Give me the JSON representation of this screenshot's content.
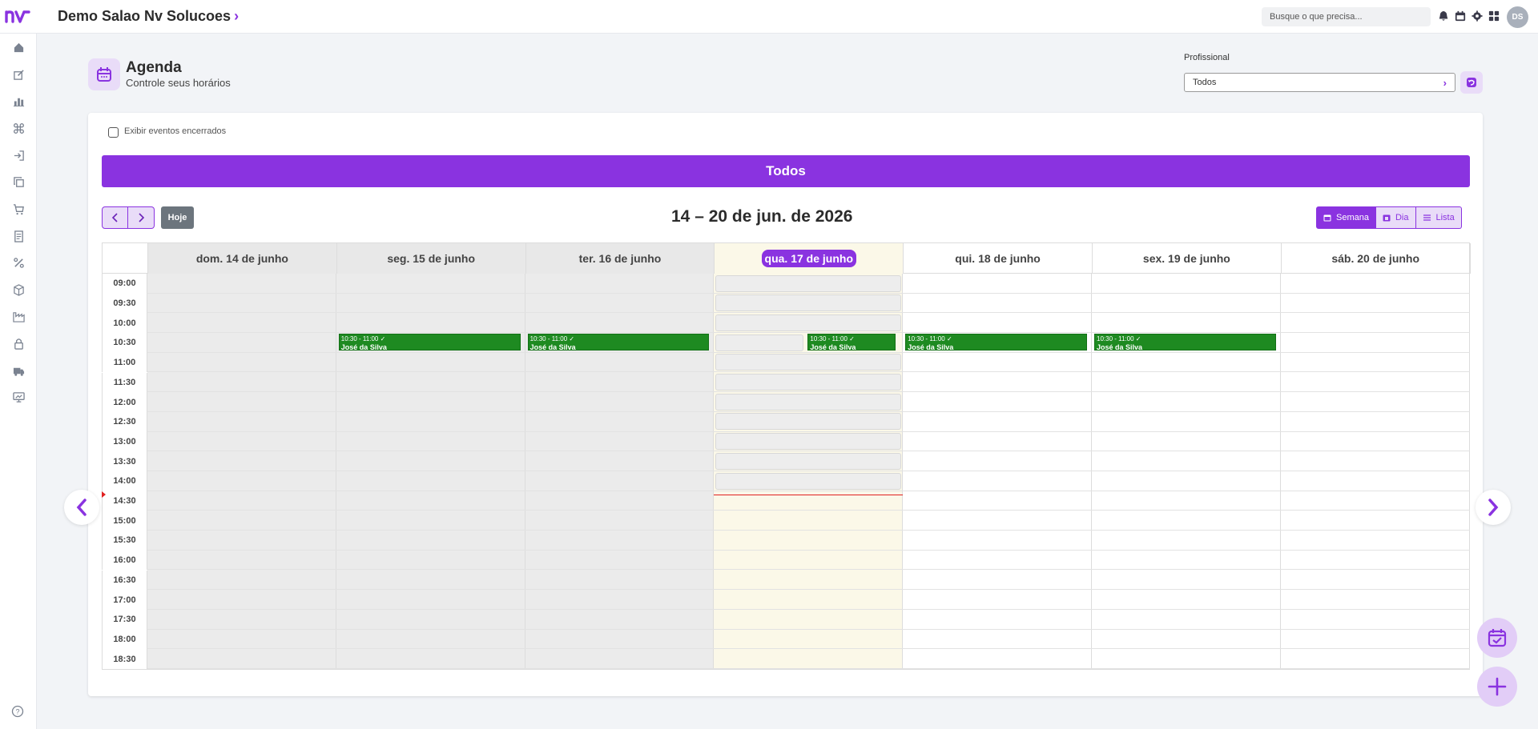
{
  "topbar": {
    "company_name": "Demo Salao Nv Solucoes",
    "search_placeholder": "Busque o que precisa...",
    "avatar_initials": "DS",
    "icons": [
      "bell-icon",
      "calendar-icon",
      "gear-icon",
      "apps-grid-icon"
    ]
  },
  "sidebar": {
    "items": [
      "home-icon",
      "edit-icon",
      "chart-bar-icon",
      "command-icon",
      "login-icon",
      "copy-icon",
      "cart-icon",
      "receipt-icon",
      "percent-icon",
      "box-icon",
      "factory-icon",
      "lock-icon",
      "truck-icon",
      "presentation-icon"
    ],
    "help_icon": "help-icon"
  },
  "header": {
    "title": "Agenda",
    "subtitle": "Controle seus horários",
    "profissional_label": "Profissional",
    "profissional_value": "Todos"
  },
  "calendar": {
    "show_closed_label": "Exibir eventos encerrados",
    "banner": "Todos",
    "today_button": "Hoje",
    "range_title": "14 – 20 de jun. de 2026",
    "views": [
      "Semana",
      "Dia",
      "Lista"
    ],
    "days": [
      "dom. 14 de junho",
      "seg. 15 de junho",
      "ter. 16 de junho",
      "qua. 17 de junho",
      "qui. 18 de junho",
      "sex. 19 de junho",
      "sáb. 20 de junho"
    ],
    "today_index": 3,
    "times": [
      "09:00",
      "09:30",
      "10:00",
      "10:30",
      "11:00",
      "11:30",
      "12:00",
      "12:30",
      "13:00",
      "13:30",
      "14:00",
      "14:30",
      "15:00",
      "15:30",
      "16:00",
      "16:30",
      "17:00",
      "17:30",
      "18:00",
      "18:30"
    ],
    "events": [
      {
        "day": 1,
        "time": "10:30 - 11:00",
        "name": "José da Silva"
      },
      {
        "day": 2,
        "time": "10:30 - 11:00",
        "name": "José da Silva"
      },
      {
        "day": 3,
        "time": "10:30 - 11:00",
        "name": "José da Silva"
      },
      {
        "day": 4,
        "time": "10:30 - 11:00",
        "name": "José da Silva"
      },
      {
        "day": 5,
        "time": "10:30 - 11:00",
        "name": "José da Silva"
      }
    ],
    "accent_color": "#8a33e0",
    "event_color": "#1e8a21"
  }
}
